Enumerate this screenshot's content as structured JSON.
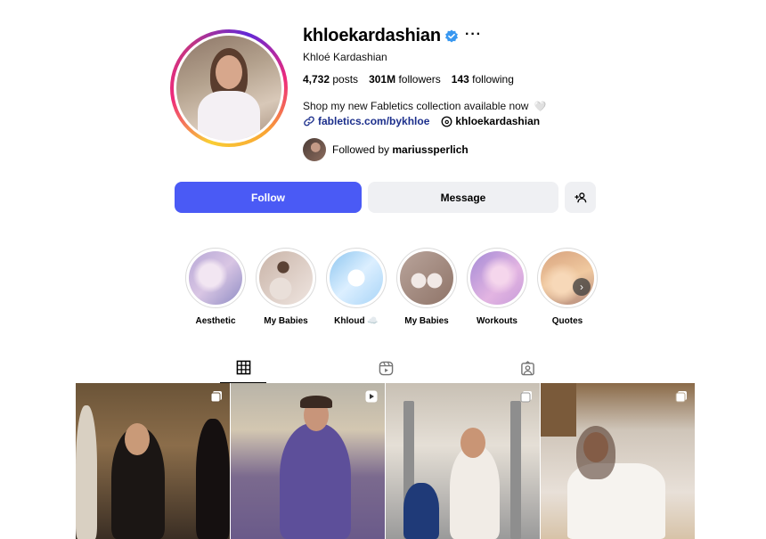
{
  "profile": {
    "username": "khloekardashian",
    "full_name": "Khloé Kardashian",
    "more_label": "···",
    "stats": {
      "posts_count": "4,732",
      "posts_label": "posts",
      "followers_count": "301M",
      "followers_label": "followers",
      "following_count": "143",
      "following_label": "following"
    },
    "bio": "Shop my new Fabletics collection available now",
    "bio_emoji": "🤍",
    "link": "fabletics.com/bykhloe",
    "threads_handle": "khloekardashian",
    "followed_by_prefix": "Followed by",
    "followed_by_user": "mariussperlich"
  },
  "actions": {
    "follow_label": "Follow",
    "message_label": "Message",
    "add_user_icon": "add-user-icon"
  },
  "highlights": [
    {
      "label": "Aesthetic"
    },
    {
      "label": "My Babies"
    },
    {
      "label": "Khloud ☁️"
    },
    {
      "label": "My Babies"
    },
    {
      "label": "Workouts"
    },
    {
      "label": "Quotes"
    }
  ],
  "tabs": [
    {
      "icon": "grid-icon",
      "active": true
    },
    {
      "icon": "reels-icon",
      "active": false
    },
    {
      "icon": "tagged-icon",
      "active": false
    }
  ],
  "posts": [
    {
      "type_icon": "carousel-icon"
    },
    {
      "type_icon": "reel-icon"
    },
    {
      "type_icon": "carousel-icon"
    },
    {
      "type_icon": "carousel-icon"
    }
  ],
  "colors": {
    "accent": "#4a5af5",
    "verified": "#3897f0",
    "link": "#1c2f8c",
    "secondary_button": "#eff0f3"
  }
}
